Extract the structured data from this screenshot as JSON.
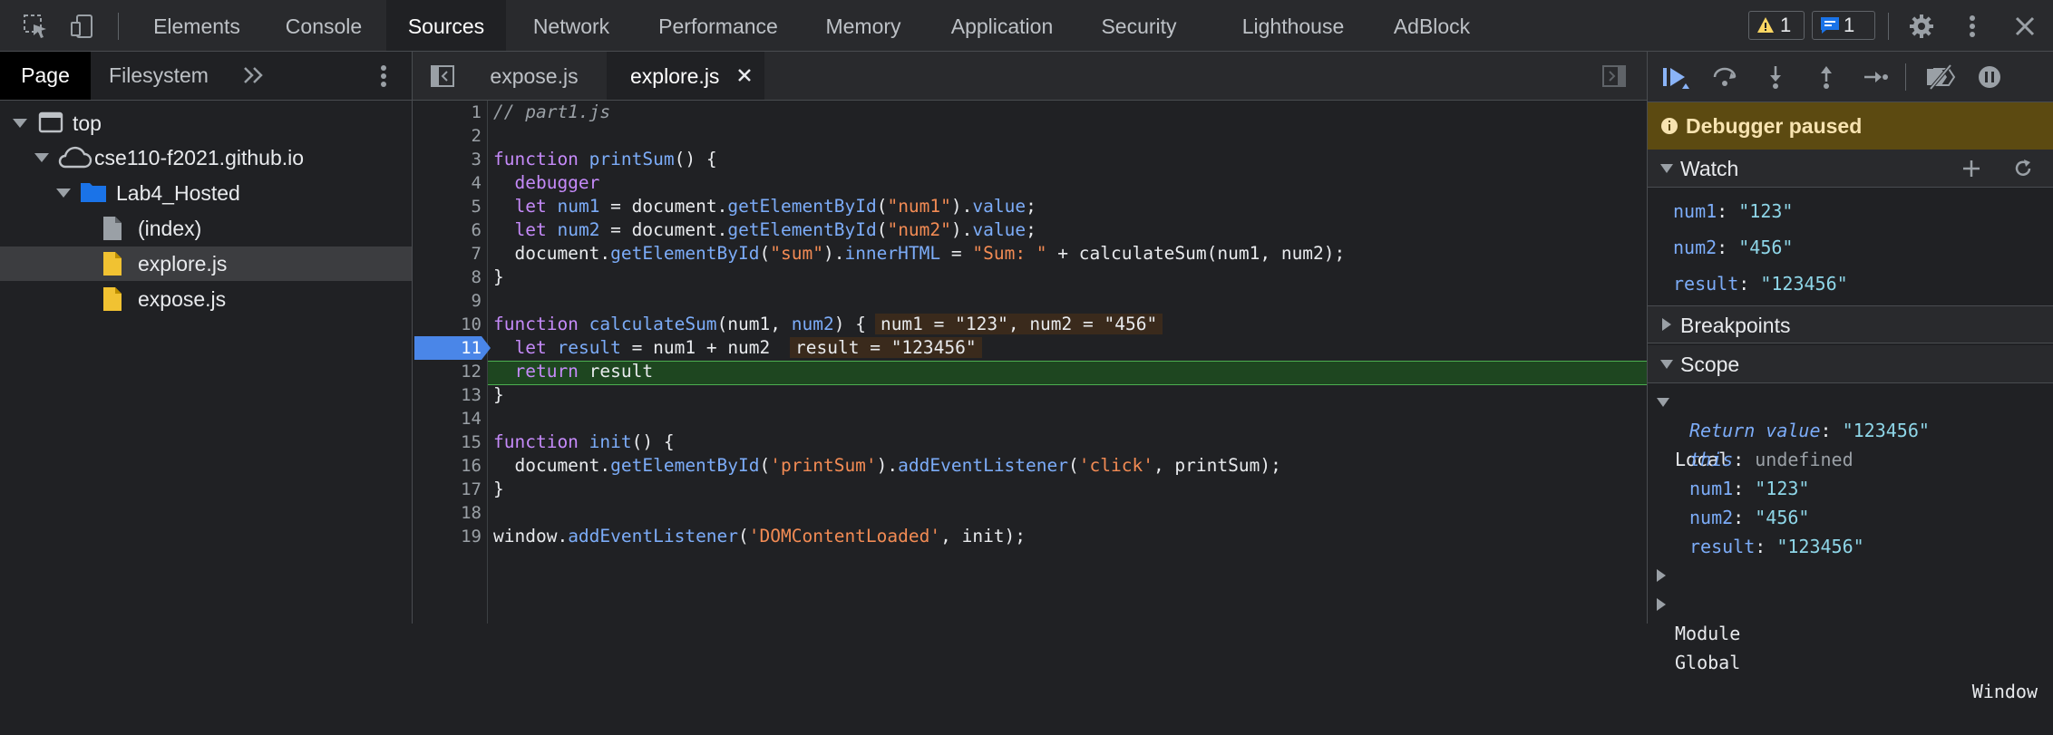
{
  "toolbar": {
    "tabs": [
      "Elements",
      "Console",
      "Sources",
      "Network",
      "Performance",
      "Memory",
      "Application",
      "Security",
      "Lighthouse",
      "AdBlock"
    ],
    "active_tab": "Sources",
    "warnings_count": "1",
    "messages_count": "1"
  },
  "navigator": {
    "tabs": [
      "Page",
      "Filesystem"
    ],
    "active_tab": "Page",
    "tree": [
      {
        "label": "top"
      },
      {
        "label": "cse110-f2021.github.io"
      },
      {
        "label": "Lab4_Hosted"
      },
      {
        "label": "(index)"
      },
      {
        "label": "explore.js"
      },
      {
        "label": "expose.js"
      }
    ],
    "selected": "explore.js"
  },
  "editor": {
    "tabs": [
      "expose.js",
      "explore.js"
    ],
    "active_tab": "explore.js",
    "line_numbers": [
      "1",
      "2",
      "3",
      "4",
      "5",
      "6",
      "7",
      "8",
      "9",
      "10",
      "11",
      "12",
      "13",
      "14",
      "15",
      "16",
      "17",
      "18",
      "19"
    ],
    "current_line": "11",
    "inline_values": {
      "line10": "num1 = \"123\", num2 = \"456\"",
      "line11": "result = \"123456\""
    }
  },
  "debugger": {
    "paused_label": "Debugger paused",
    "watch": {
      "title": "Watch",
      "items": [
        {
          "name": "num1",
          "value": "\"123\""
        },
        {
          "name": "num2",
          "value": "\"456\""
        },
        {
          "name": "result",
          "value": "\"123456\""
        }
      ]
    },
    "breakpoints_title": "Breakpoints",
    "scope": {
      "title": "Scope",
      "local_title": "Local",
      "local": [
        {
          "name": "Return value",
          "value": "\"123456\""
        },
        {
          "name": "this",
          "value": "undefined"
        },
        {
          "name": "num1",
          "value": "\"123\""
        },
        {
          "name": "num2",
          "value": "\"456\""
        },
        {
          "name": "result",
          "value": "\"123456\""
        }
      ],
      "module_title": "Module",
      "global_title": "Global",
      "global_value": "Window"
    }
  },
  "colors": {
    "accent": "#8ab4f8",
    "paused_bg": "#5c4a11",
    "exec_line": "#1e4620",
    "breakpoint": "#4a86e8"
  }
}
